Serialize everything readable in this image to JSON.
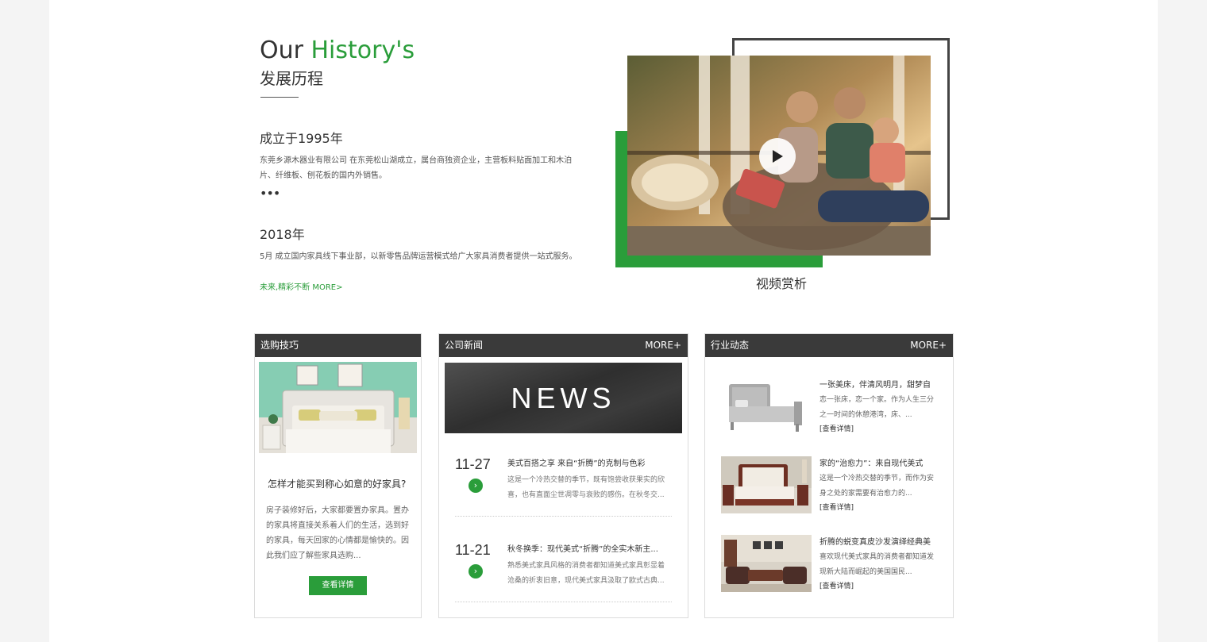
{
  "history": {
    "title_prefix": "Our ",
    "title_highlight": "History's",
    "subtitle": "发展历程",
    "year1": "成立于1995年",
    "desc1": "东莞乡源木器业有限公司 在东莞松山湖成立，属台商独资企业，主营板料贴面加工和木泊片、纤维板、刨花板的国内外销售。",
    "dots": "•••",
    "year2": "2018年",
    "desc2": "5月 成立国内家具线下事业部，以新零售品牌运营模式给广大家具消费者提供一站式服务。",
    "more": "未来,精彩不断 MORE>"
  },
  "video": {
    "caption": "视频赏析"
  },
  "tips": {
    "header": "选购技巧",
    "title": "怎样才能买到称心如意的好家具?",
    "desc": "房子装修好后，大家都要置办家具。置办的家具将直接关系着人们的生活，选到好的家具，每天回家的心情都是愉快的。因此我们应了解些家具选购...",
    "button": "查看详情"
  },
  "company_news": {
    "header": "公司新闻",
    "more": "MORE+",
    "banner": "NEWS",
    "items": [
      {
        "date": "11-27",
        "title": "美式百搭之享 来自“折腾”的克制与色彩",
        "desc": "这是一个冷热交替的季节，既有饱尝收获果实的欣喜，也有直面尘世凋零与衰败的感伤。在秋冬交..."
      },
      {
        "date": "11-21",
        "title": "秋冬换季：现代美式“折腾”的全实木新主...",
        "desc": "熟悉美式家具风格的消费者都知道美式家具彰显着沧桑的折衷旧意，现代美式家具汲取了欧式古典..."
      }
    ]
  },
  "industry_news": {
    "header": "行业动态",
    "more": "MORE+",
    "items": [
      {
        "title": "一张美床，伴清风明月，甜梦自",
        "desc": "恋一张床，恋一个家。作为人生三分之一时间的休憩港湾，床、...",
        "link": "[查看详情]"
      },
      {
        "title": "家的“治愈力”：来自现代美式",
        "desc": "这是一个冷热交替的季节，而作为安身之处的家需要有治愈力的...",
        "link": "[查看详情]"
      },
      {
        "title": "折腾的蜕变真皮沙发演绎经典美",
        "desc": "喜欢现代美式家具的消费者都知道发现新大陆而崛起的美国国民...",
        "link": "[查看详情]"
      }
    ]
  },
  "colors": {
    "accent": "#2a9d3a",
    "header_dark": "#3a3a3a"
  }
}
